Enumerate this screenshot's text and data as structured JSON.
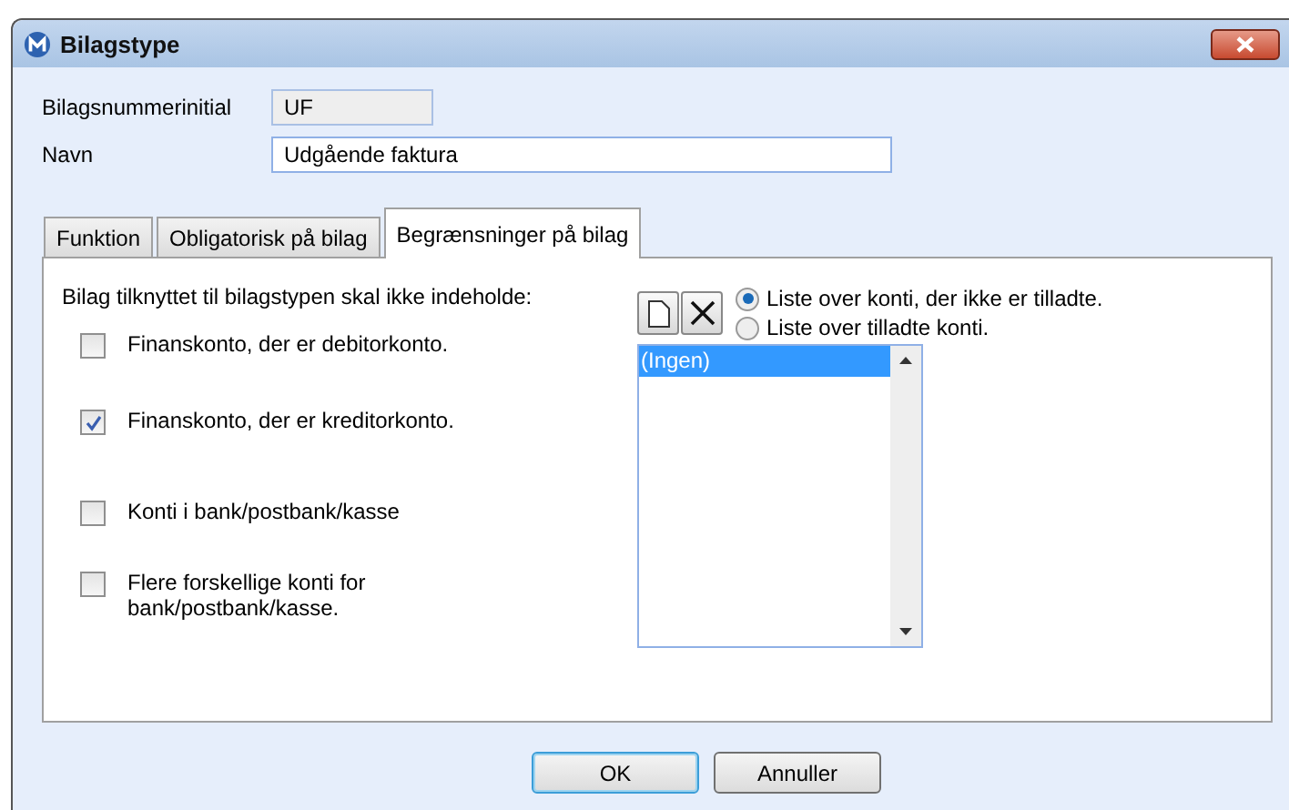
{
  "window": {
    "title": "Bilagstype"
  },
  "fields": [
    {
      "label": "Bilagsnummerinitial",
      "value": "UF",
      "readonly": true
    },
    {
      "label": "Navn",
      "value": "Udgående faktura",
      "readonly": false
    }
  ],
  "tabs": [
    {
      "label": "Funktion",
      "selected": false
    },
    {
      "label": "Obligatorisk på bilag",
      "selected": false
    },
    {
      "label": "Begrænsninger på bilag",
      "selected": true
    }
  ],
  "panel": {
    "heading": "Bilag tilknyttet til bilagstypen skal ikke indeholde:",
    "checkboxes": [
      {
        "label": "Finanskonto, der er debitorkonto.",
        "checked": false
      },
      {
        "label": "Finanskonto, der er kreditorkonto.",
        "checked": true
      },
      {
        "label": "Konti i bank/postbank/kasse",
        "checked": false
      },
      {
        "label": "Flere forskellige konti for bank/postbank/kasse.",
        "checked": false
      }
    ],
    "radios": [
      {
        "label": "Liste over konti, der ikke er tilladte.",
        "selected": true
      },
      {
        "label": "Liste over tilladte konti.",
        "selected": false
      }
    ],
    "list": [
      {
        "label": "(Ingen)",
        "selected": true
      }
    ]
  },
  "buttons": [
    {
      "label": "OK",
      "default": true
    },
    {
      "label": "Annuller",
      "default": false
    }
  ]
}
